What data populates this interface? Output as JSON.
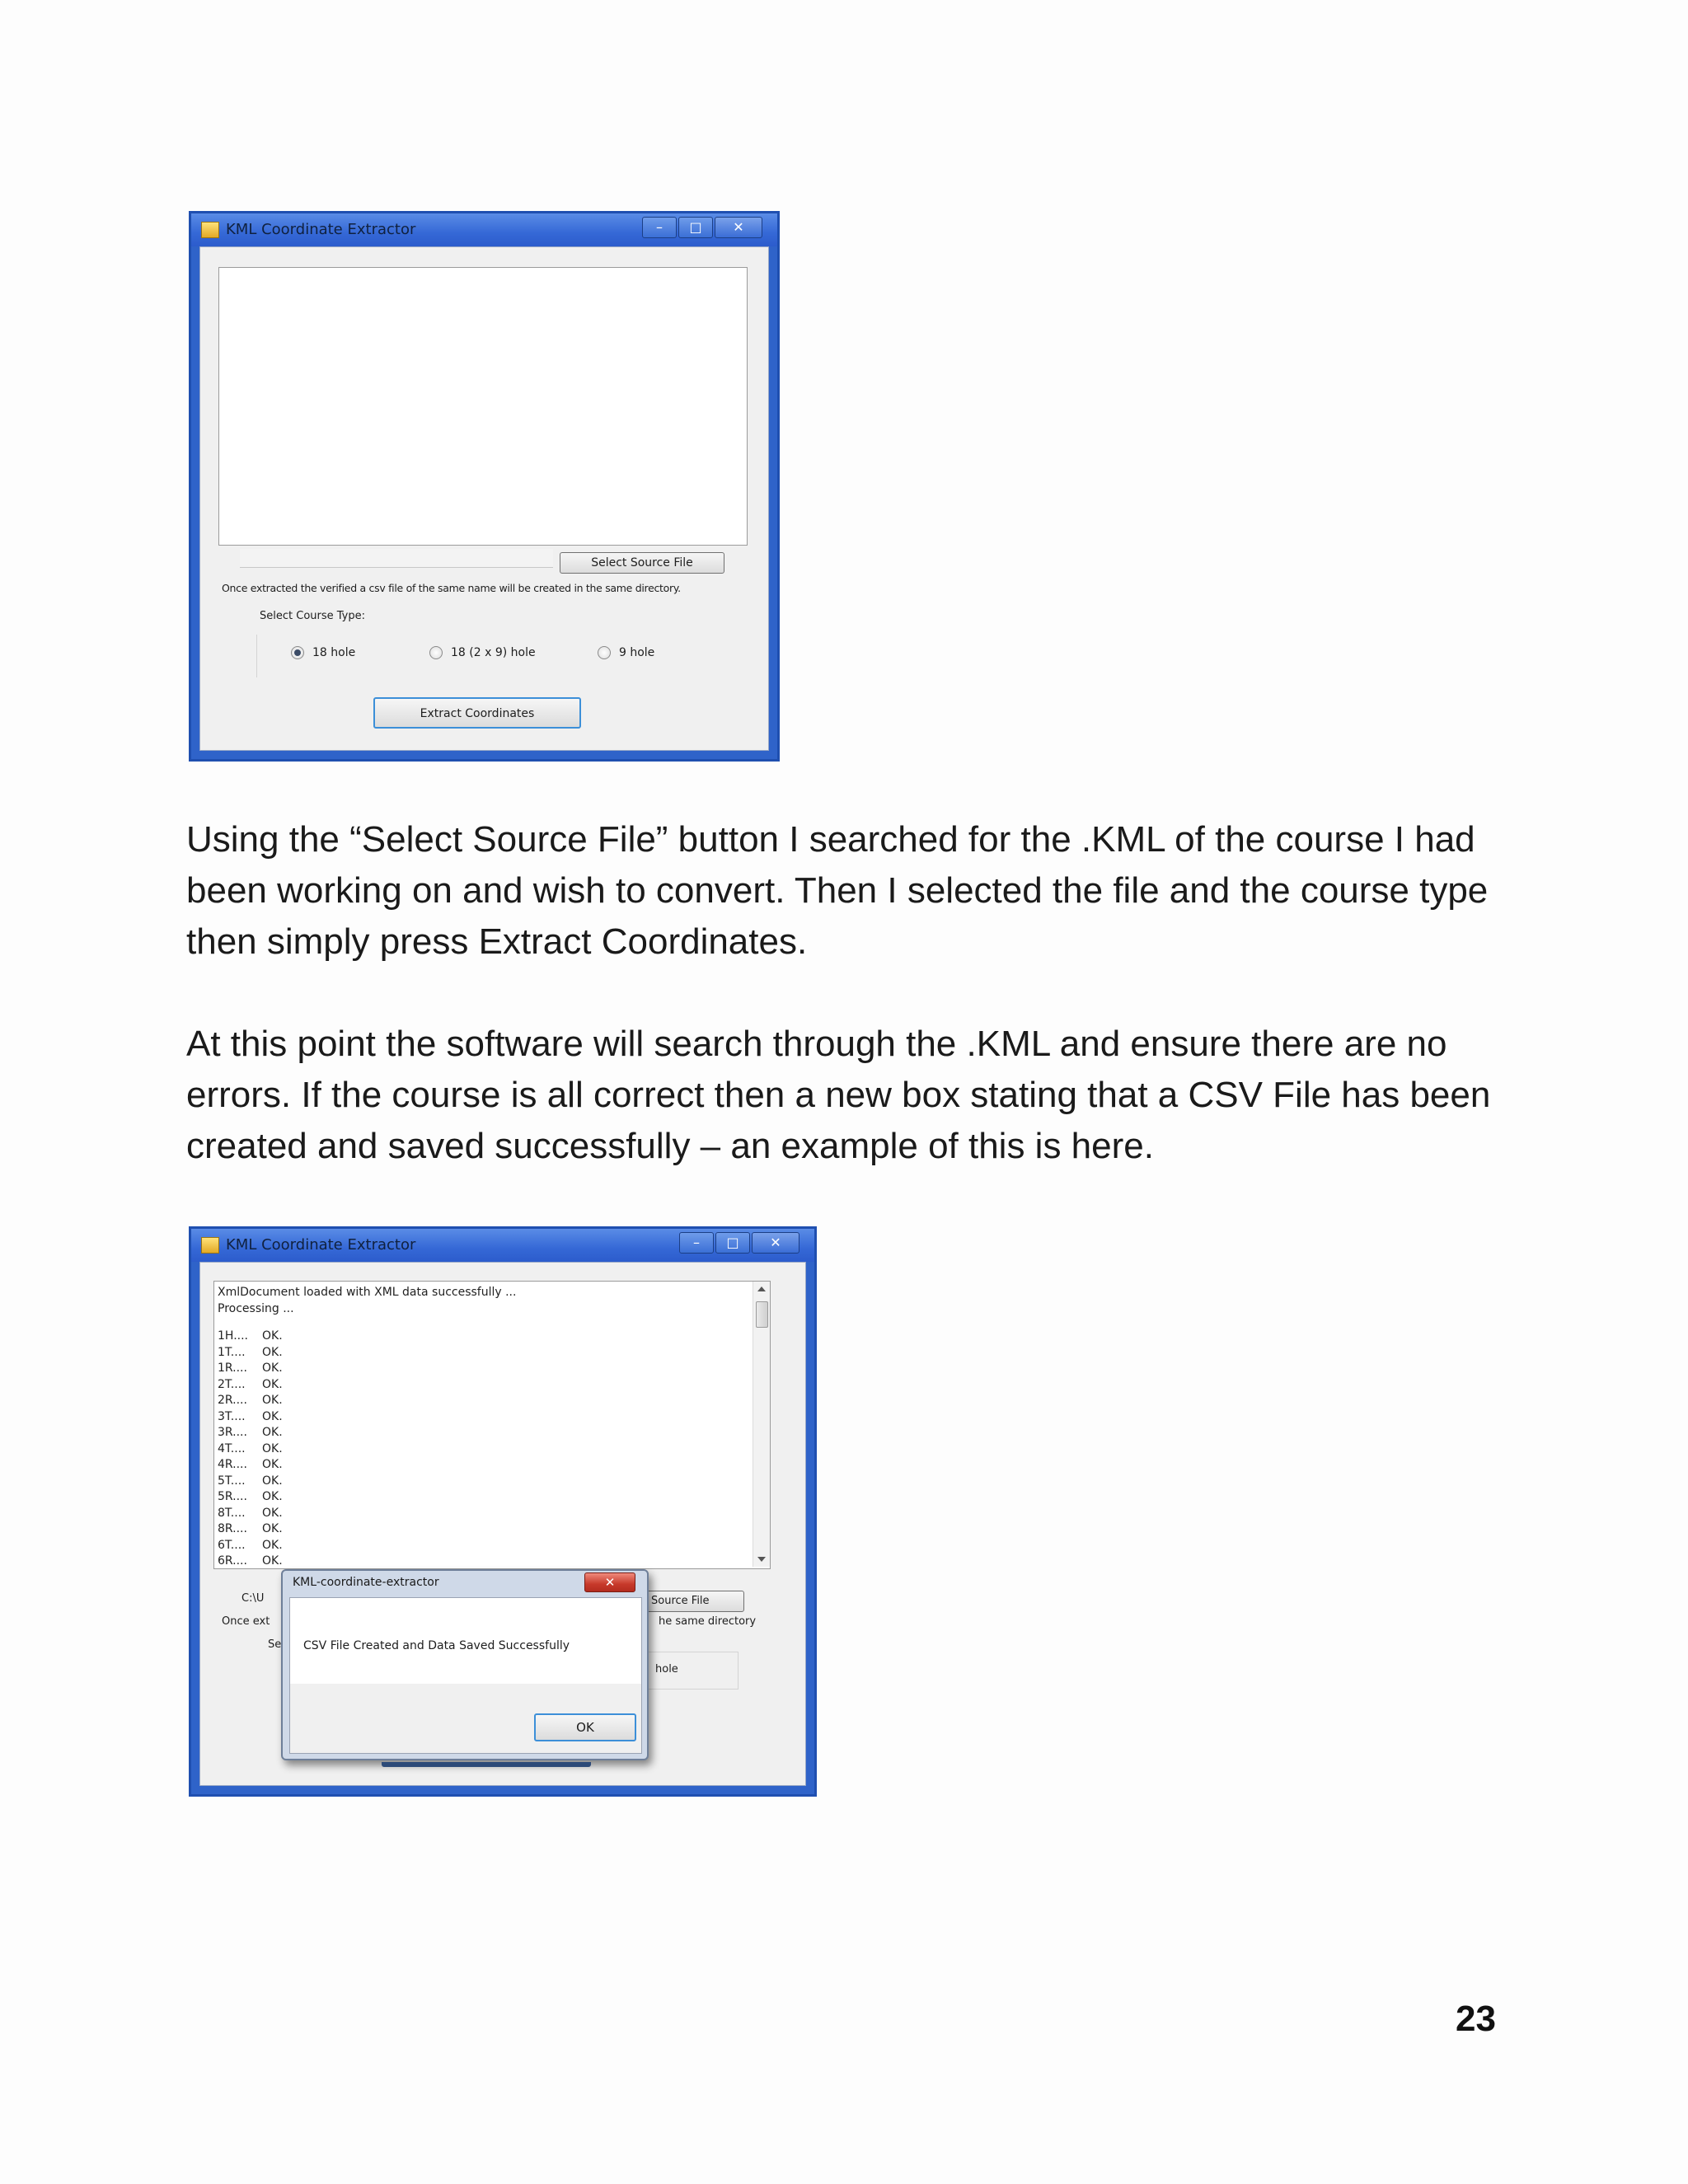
{
  "window1": {
    "title": "KML Coordinate Extractor",
    "controls": {
      "minimize": "–",
      "maximize": "□",
      "close": "✕"
    },
    "select_source_button": "Select Source File",
    "info_text": "Once extracted the verified a csv file of the same name will be created in the same directory.",
    "course_type_label": "Select Course Type:",
    "radio_options": [
      "18 hole",
      "18 (2 x 9) hole",
      "9 hole"
    ],
    "selected_option": "18 hole",
    "extract_button": "Extract Coordinates"
  },
  "paragraphs": [
    "Using the “Select Source File” button I searched for the .KML of the course I had been working on and wish to convert. Then I selected the file and the course type then simply press Extract Coordinates.",
    "At this point the software will search through the .KML and ensure there are no errors. If the course is all correct then a new box stating that a CSV File has been created and saved successfully – an example of this is here."
  ],
  "window2": {
    "title": "KML Coordinate Extractor",
    "controls": {
      "minimize": "–",
      "maximize": "□",
      "close": "✕"
    },
    "log_header": [
      "XmlDocument loaded with XML data successfully ...",
      "Processing ..."
    ],
    "log_rows": [
      {
        "code": "1H....",
        "status": "OK."
      },
      {
        "code": "1T....",
        "status": "OK."
      },
      {
        "code": "1R....",
        "status": "OK."
      },
      {
        "code": "2T....",
        "status": "OK."
      },
      {
        "code": "2R....",
        "status": "OK."
      },
      {
        "code": "3T....",
        "status": "OK."
      },
      {
        "code": "3R....",
        "status": "OK."
      },
      {
        "code": "4T....",
        "status": "OK."
      },
      {
        "code": "4R....",
        "status": "OK."
      },
      {
        "code": "5T....",
        "status": "OK."
      },
      {
        "code": "5R....",
        "status": "OK."
      },
      {
        "code": "8T....",
        "status": "OK."
      },
      {
        "code": "8R....",
        "status": "OK."
      },
      {
        "code": "6T....",
        "status": "OK."
      },
      {
        "code": "6R....",
        "status": "OK."
      }
    ],
    "path_partial": "C:\\U",
    "info_partial_left": "Once ext",
    "info_partial_right": "he same directory",
    "label_partial": "Se",
    "source_button_partial": "Source File",
    "radio_partial": "hole"
  },
  "dialog": {
    "title": "KML-coordinate-extractor",
    "close": "✕",
    "message": "CSV File Created and Data Saved Successfully",
    "ok_button": "OK"
  },
  "page_number": "23"
}
